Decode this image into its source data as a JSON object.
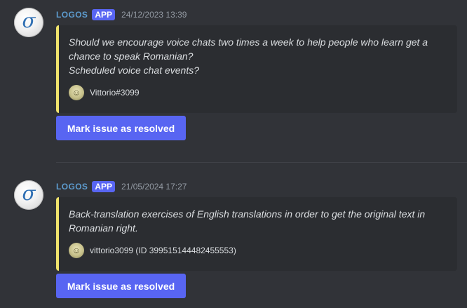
{
  "colors": {
    "background": "#313338",
    "embed_background": "#2b2d31",
    "embed_accent": "#f0e36c",
    "username": "#5d9ccf",
    "button": "#5865f2"
  },
  "messages": [
    {
      "avatar_icon": "sigma-logo-icon",
      "avatar_glyph": "σ",
      "username": "LOGOS",
      "badge": "APP",
      "timestamp": "24/12/2023 13:39",
      "embed_text": "Should we encourage voice chats two times a week to help people who learn get a chance to speak Romanian?\nScheduled voice chat events?",
      "footer_avatar_icon": "user-avatar-icon",
      "footer_text": "Vittorio#3099",
      "button_label": "Mark issue as resolved"
    },
    {
      "avatar_icon": "sigma-logo-icon",
      "avatar_glyph": "σ",
      "username": "LOGOS",
      "badge": "APP",
      "timestamp": "21/05/2024 17:27",
      "embed_text": "Back-translation exercises of English translations in order to get the original text in Romanian right.",
      "footer_avatar_icon": "user-avatar-icon",
      "footer_text": "vittorio3099 (ID 399515144482455553)",
      "button_label": "Mark issue as resolved"
    }
  ]
}
